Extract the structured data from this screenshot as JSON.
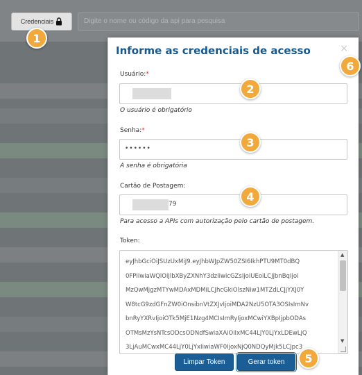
{
  "toolbar": {
    "credentials_label": "Credenciais",
    "search_placeholder": "Digite o nome ou código da api para pesquisa"
  },
  "modal": {
    "title": "Informe as credenciais de acesso",
    "close_glyph": "×",
    "user": {
      "label": "Usuário:",
      "required_mark": "*",
      "hint": "O usuário é obrigatório"
    },
    "password": {
      "label": "Senha:",
      "required_mark": "*",
      "value": "••••••",
      "hint": "A senha é obrigatória"
    },
    "card": {
      "label": "Cartão de Postagem:",
      "value_visible_suffix": "79",
      "hint": "Para acesso a APIs com autorização pelo cartão de postagem."
    },
    "token": {
      "label": "Token:",
      "lines": [
        "eyJhbGciOiJSUzUxMiJ9.eyJhbWJpZW50ZSI6IkhPTU9MT0dBQ",
        "0FPIiwiaWQiOiJlbXByZXNhY3dzIiwicGZsIjoiUEoiLCJjbnBqIjoi",
        "MzQwMjgzMTYwMDAxMDMiLCJhcGkiOlszNiw1MTZdLCJjYXJ0Y",
        "W8tcG9zdGFnZW0iOnsibnVtZXJvIjoiMDA2NzU5OTA3OSIsImNv",
        "bnRyYXRvIjoiOTk5MjE1Nzg4MCIsImRyIjoxMCwiYXBpIjpbODAs",
        "OTMsMzYsNTcsODcsODNdfSwiaXAiOiIxMC44LjY0LjYxLDEwLjQ",
        "3LjAuMCwxMC44LjY0LjYxIiwiaWF0IjoxNjQ0NDQyMjk5LCJpc3"
      ]
    },
    "buttons": {
      "clear": "Limpar Token",
      "generate": "Gerar token"
    }
  },
  "callouts": [
    "1",
    "2",
    "3",
    "4",
    "5",
    "6"
  ],
  "colors": {
    "accent": "#17598c",
    "button": "#1a5e95",
    "callout": "#f2a93b"
  }
}
